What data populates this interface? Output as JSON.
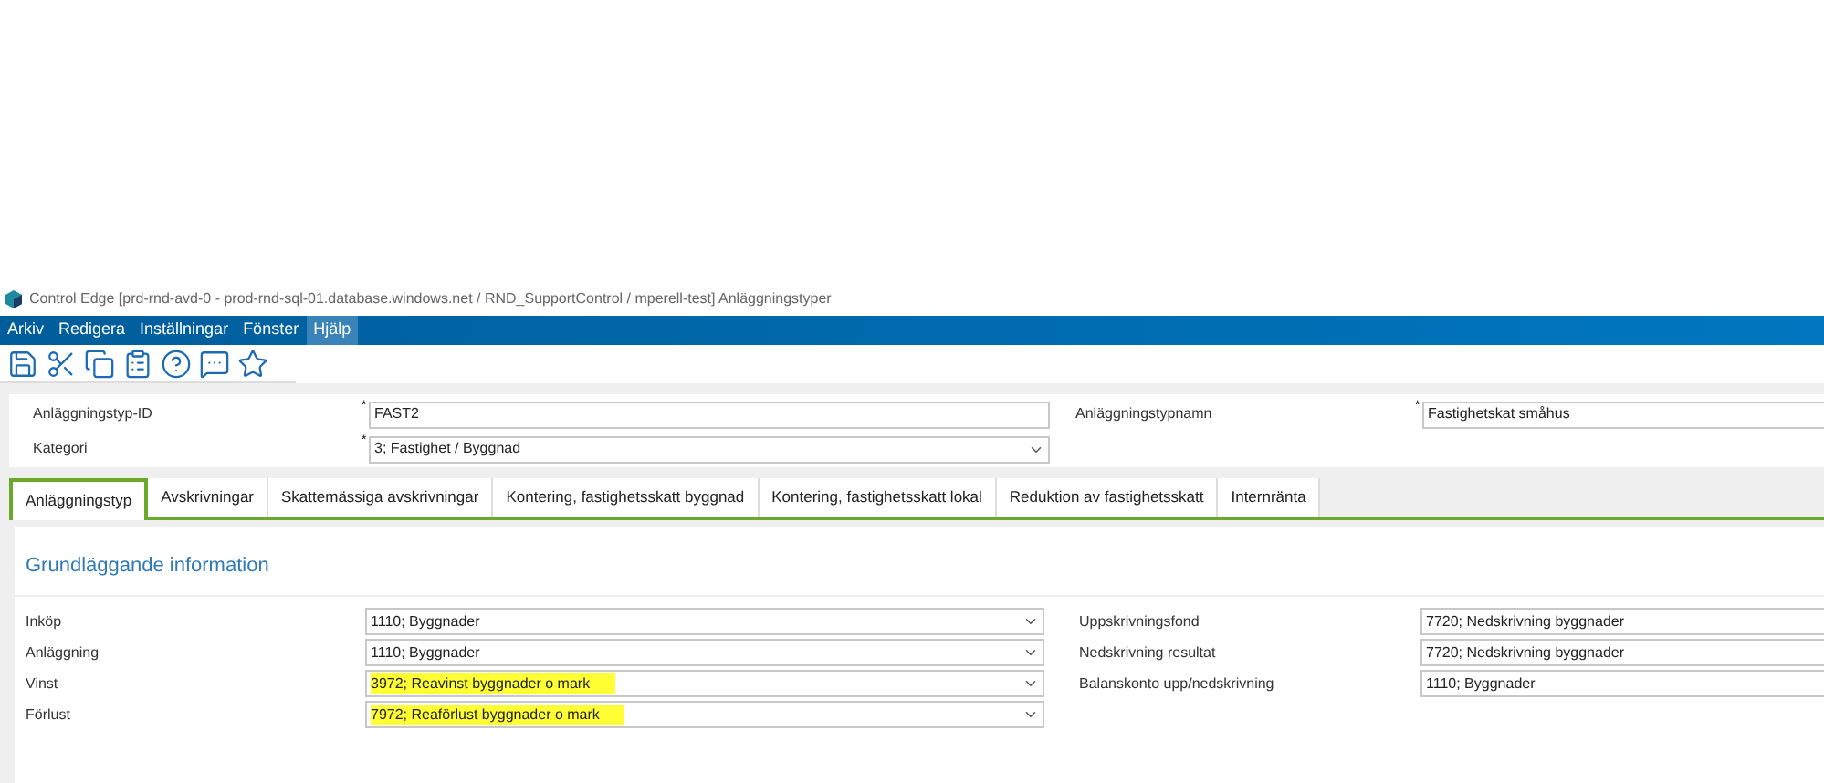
{
  "window": {
    "title": "Control Edge [prd-rnd-avd-0 - prod-rnd-sql-01.database.windows.net / RND_SupportControl / mperell-test] Anläggningstyper"
  },
  "menu": [
    {
      "label": "Arkiv",
      "selected": false
    },
    {
      "label": "Redigera",
      "selected": false
    },
    {
      "label": "Inställningar",
      "selected": false
    },
    {
      "label": "Fönster",
      "selected": false
    },
    {
      "label": "Hjälp",
      "selected": true
    }
  ],
  "toolbar": [
    {
      "kind": "save"
    },
    {
      "kind": "cut"
    },
    {
      "kind": "copy"
    },
    {
      "kind": "paste"
    },
    {
      "kind": "help"
    },
    {
      "kind": "chat"
    },
    {
      "kind": "favorite"
    }
  ],
  "header": {
    "left": [
      {
        "label": "Anläggningstyp-ID",
        "value": "FAST2",
        "kind": "text",
        "marker": "*"
      },
      {
        "label": "Kategori",
        "value": "3; Fastighet / Byggnad",
        "kind": "dropdown",
        "marker": "*"
      }
    ],
    "right": [
      {
        "label": "Anläggningstypnamn",
        "value": "Fastighetskat småhus",
        "marker": "*"
      }
    ]
  },
  "tabs": [
    {
      "label": "Anläggningstyp",
      "selected": true
    },
    {
      "label": "Avskrivningar",
      "selected": false
    },
    {
      "label": "Skattemässiga avskrivningar",
      "selected": false
    },
    {
      "label": "Kontering, fastighetsskatt byggnad",
      "selected": false
    },
    {
      "label": "Kontering, fastighetsskatt lokal",
      "selected": false
    },
    {
      "label": "Reduktion av fastighetsskatt",
      "selected": false
    },
    {
      "label": "Internränta",
      "selected": false
    }
  ],
  "section": {
    "title": "Grundläggande information",
    "left": [
      {
        "label": "Inköp",
        "value": "1110; Byggnader",
        "highlighted": false
      },
      {
        "label": "Anläggning",
        "value": "1110; Byggnader",
        "highlighted": false
      },
      {
        "label": "Vinst",
        "value": "3972; Reavinst byggnader o mark",
        "highlighted": true
      },
      {
        "label": "Förlust",
        "value": "7972; Reaförlust byggnader o mark",
        "highlighted": true
      }
    ],
    "right": [
      {
        "label": "Uppskrivningsfond",
        "value": "7720; Nedskrivning byggnader"
      },
      {
        "label": "Nedskrivning resultat",
        "value": "7720; Nedskrivning byggnader"
      },
      {
        "label": "Balanskonto upp/nedskrivning",
        "value": "1110; Byggnader"
      }
    ]
  }
}
